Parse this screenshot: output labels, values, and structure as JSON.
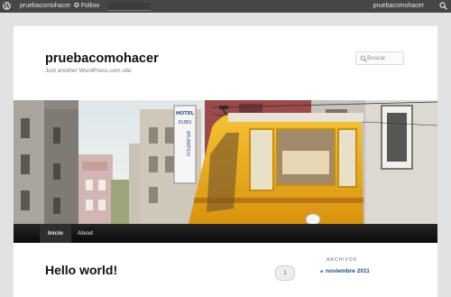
{
  "admin_bar": {
    "site_name": "pruebacomohacer",
    "follow_label": "Follow",
    "user_name": "pruebacomohacer"
  },
  "header": {
    "site_title": "pruebacomohacer",
    "site_description": "Just another WordPress.com site",
    "search_placeholder": "Buscar"
  },
  "nav": {
    "items": [
      {
        "label": "Inicio",
        "current": true
      },
      {
        "label": "About",
        "current": false
      }
    ]
  },
  "post": {
    "title": "Hello world!",
    "comment_count": "1"
  },
  "sidebar": {
    "widget_title": "ARCHIVOS",
    "archives": [
      "noviembre 2011"
    ]
  },
  "colors": {
    "admin_bar": "#464646",
    "nav_bar": "#1a1a1a",
    "tram_yellow": "#f2b21e",
    "link": "#1e4d79"
  },
  "icons": [
    "wordpress-logo-icon",
    "star-icon",
    "search-icon"
  ]
}
